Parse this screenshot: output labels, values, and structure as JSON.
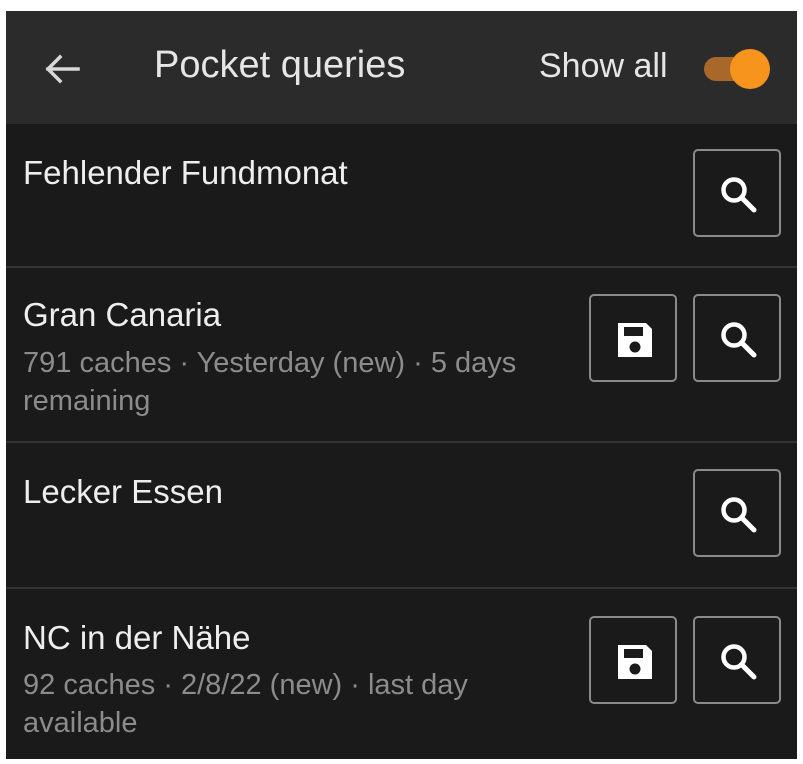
{
  "header": {
    "title": "Pocket queries",
    "show_all_label": "Show all",
    "show_all_on": true,
    "accent_color": "#f7941d"
  },
  "queries": [
    {
      "name": "Fehlender Fundmonat",
      "detail": "",
      "actions": [
        "search-icon"
      ]
    },
    {
      "name": "Gran Canaria",
      "detail": "791 caches · Yesterday (new) · 5 days remaining",
      "actions": [
        "save-icon",
        "search-icon"
      ]
    },
    {
      "name": "Lecker Essen",
      "detail": "",
      "actions": [
        "search-icon"
      ]
    },
    {
      "name": "NC in der Nähe",
      "detail": "92 caches · 2/8/22 (new) · last day available",
      "actions": [
        "save-icon",
        "search-icon"
      ]
    }
  ]
}
